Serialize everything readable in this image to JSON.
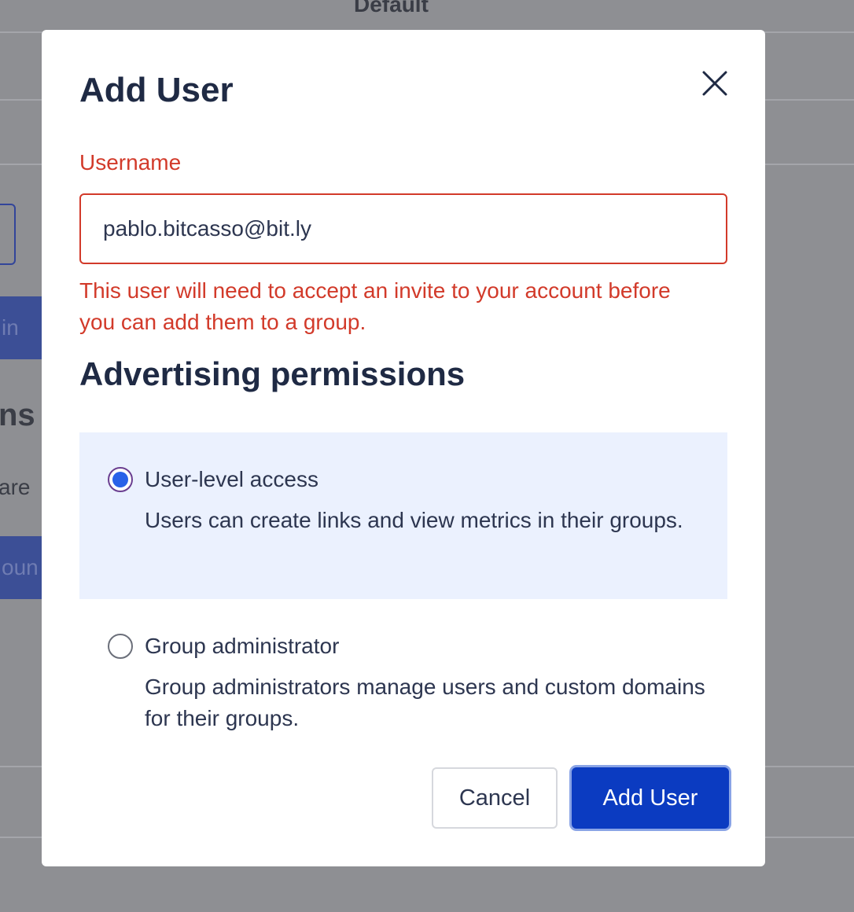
{
  "background": {
    "column_header": "Default",
    "fragments": [
      "in",
      "ns",
      "are",
      "oun"
    ]
  },
  "modal": {
    "title": "Add User",
    "close_label": "Close",
    "username": {
      "label": "Username",
      "value": "pablo.bitcasso@bit.ly",
      "error": "This user will need to accept an invite to your account before you can add them to a group."
    },
    "permissions": {
      "title": "Advertising permissions",
      "options": [
        {
          "label": "User-level access",
          "description": "Users can create links and view metrics in their groups.",
          "selected": true
        },
        {
          "label": "Group administrator",
          "description": "Group administrators manage users and custom domains for their groups.",
          "selected": false
        }
      ]
    },
    "actions": {
      "cancel_label": "Cancel",
      "submit_label": "Add User"
    }
  },
  "colors": {
    "error": "#d23a2a",
    "primary": "#0b3bc1",
    "selected_bg": "#ebf1fe",
    "overlay": "#8e8f93"
  }
}
